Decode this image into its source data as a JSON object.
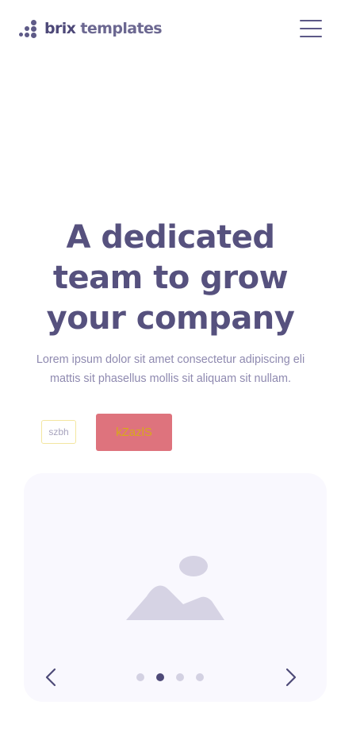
{
  "header": {
    "logo_word_1": "brix",
    "logo_word_2": " templates",
    "logo_icon": "dots-logo-icon",
    "menu_icon": "hamburger-menu-icon"
  },
  "hero": {
    "title": "A dedicated\nteam to grow\nyour company",
    "subtitle": "Lorem ipsum dolor sit amet consectetur adipiscing eli mattis sit phasellus mollis sit aliquam sit nullam."
  },
  "actions": {
    "small_box_text": "szbh",
    "button_label": "kZazlS"
  },
  "carousel": {
    "image_icon": "image-placeholder-icon",
    "prev_icon": "chevron-left-icon",
    "next_icon": "chevron-right-icon",
    "total_slides": 4,
    "active_slide": 2
  },
  "colors": {
    "brand": "#56517e",
    "muted_text": "#8f8ab0",
    "button_bg": "#de737d",
    "button_text": "#d8a91c",
    "card_bg": "#f9f8fe",
    "dot_inactive": "#d3d1e2",
    "dot_active": "#4e4a78"
  }
}
